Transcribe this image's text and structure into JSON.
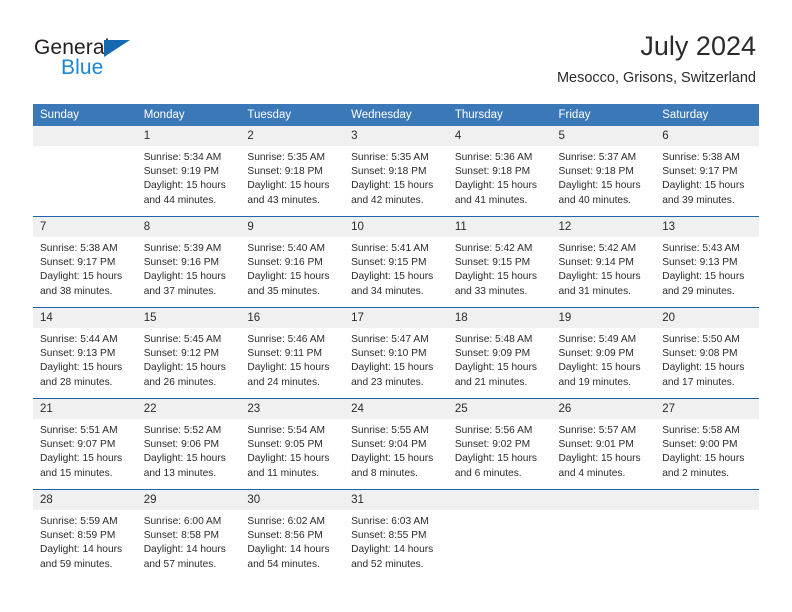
{
  "brand": {
    "name_part1": "General",
    "name_part2": "Blue",
    "triangle_icon": "triangle-icon",
    "accent_dark": "#231f20",
    "accent_blue": "#1b87d4",
    "triangle_blue": "#1469b0"
  },
  "header": {
    "title": "July 2024",
    "subtitle": "Mesocco, Grisons, Switzerland"
  },
  "theme": {
    "header_bg": "#3b78b8",
    "row_border": "#1f64a8",
    "daynum_bg": "#f0f0f0",
    "text": "#2b2b2b"
  },
  "weekday_headers": [
    "Sunday",
    "Monday",
    "Tuesday",
    "Wednesday",
    "Thursday",
    "Friday",
    "Saturday"
  ],
  "weeks": [
    [
      {
        "day": "",
        "details": ""
      },
      {
        "day": "1",
        "details": "Sunrise: 5:34 AM\nSunset: 9:19 PM\nDaylight: 15 hours\nand 44 minutes."
      },
      {
        "day": "2",
        "details": "Sunrise: 5:35 AM\nSunset: 9:18 PM\nDaylight: 15 hours\nand 43 minutes."
      },
      {
        "day": "3",
        "details": "Sunrise: 5:35 AM\nSunset: 9:18 PM\nDaylight: 15 hours\nand 42 minutes."
      },
      {
        "day": "4",
        "details": "Sunrise: 5:36 AM\nSunset: 9:18 PM\nDaylight: 15 hours\nand 41 minutes."
      },
      {
        "day": "5",
        "details": "Sunrise: 5:37 AM\nSunset: 9:18 PM\nDaylight: 15 hours\nand 40 minutes."
      },
      {
        "day": "6",
        "details": "Sunrise: 5:38 AM\nSunset: 9:17 PM\nDaylight: 15 hours\nand 39 minutes."
      }
    ],
    [
      {
        "day": "7",
        "details": "Sunrise: 5:38 AM\nSunset: 9:17 PM\nDaylight: 15 hours\nand 38 minutes."
      },
      {
        "day": "8",
        "details": "Sunrise: 5:39 AM\nSunset: 9:16 PM\nDaylight: 15 hours\nand 37 minutes."
      },
      {
        "day": "9",
        "details": "Sunrise: 5:40 AM\nSunset: 9:16 PM\nDaylight: 15 hours\nand 35 minutes."
      },
      {
        "day": "10",
        "details": "Sunrise: 5:41 AM\nSunset: 9:15 PM\nDaylight: 15 hours\nand 34 minutes."
      },
      {
        "day": "11",
        "details": "Sunrise: 5:42 AM\nSunset: 9:15 PM\nDaylight: 15 hours\nand 33 minutes."
      },
      {
        "day": "12",
        "details": "Sunrise: 5:42 AM\nSunset: 9:14 PM\nDaylight: 15 hours\nand 31 minutes."
      },
      {
        "day": "13",
        "details": "Sunrise: 5:43 AM\nSunset: 9:13 PM\nDaylight: 15 hours\nand 29 minutes."
      }
    ],
    [
      {
        "day": "14",
        "details": "Sunrise: 5:44 AM\nSunset: 9:13 PM\nDaylight: 15 hours\nand 28 minutes."
      },
      {
        "day": "15",
        "details": "Sunrise: 5:45 AM\nSunset: 9:12 PM\nDaylight: 15 hours\nand 26 minutes."
      },
      {
        "day": "16",
        "details": "Sunrise: 5:46 AM\nSunset: 9:11 PM\nDaylight: 15 hours\nand 24 minutes."
      },
      {
        "day": "17",
        "details": "Sunrise: 5:47 AM\nSunset: 9:10 PM\nDaylight: 15 hours\nand 23 minutes."
      },
      {
        "day": "18",
        "details": "Sunrise: 5:48 AM\nSunset: 9:09 PM\nDaylight: 15 hours\nand 21 minutes."
      },
      {
        "day": "19",
        "details": "Sunrise: 5:49 AM\nSunset: 9:09 PM\nDaylight: 15 hours\nand 19 minutes."
      },
      {
        "day": "20",
        "details": "Sunrise: 5:50 AM\nSunset: 9:08 PM\nDaylight: 15 hours\nand 17 minutes."
      }
    ],
    [
      {
        "day": "21",
        "details": "Sunrise: 5:51 AM\nSunset: 9:07 PM\nDaylight: 15 hours\nand 15 minutes."
      },
      {
        "day": "22",
        "details": "Sunrise: 5:52 AM\nSunset: 9:06 PM\nDaylight: 15 hours\nand 13 minutes."
      },
      {
        "day": "23",
        "details": "Sunrise: 5:54 AM\nSunset: 9:05 PM\nDaylight: 15 hours\nand 11 minutes."
      },
      {
        "day": "24",
        "details": "Sunrise: 5:55 AM\nSunset: 9:04 PM\nDaylight: 15 hours\nand 8 minutes."
      },
      {
        "day": "25",
        "details": "Sunrise: 5:56 AM\nSunset: 9:02 PM\nDaylight: 15 hours\nand 6 minutes."
      },
      {
        "day": "26",
        "details": "Sunrise: 5:57 AM\nSunset: 9:01 PM\nDaylight: 15 hours\nand 4 minutes."
      },
      {
        "day": "27",
        "details": "Sunrise: 5:58 AM\nSunset: 9:00 PM\nDaylight: 15 hours\nand 2 minutes."
      }
    ],
    [
      {
        "day": "28",
        "details": "Sunrise: 5:59 AM\nSunset: 8:59 PM\nDaylight: 14 hours\nand 59 minutes."
      },
      {
        "day": "29",
        "details": "Sunrise: 6:00 AM\nSunset: 8:58 PM\nDaylight: 14 hours\nand 57 minutes."
      },
      {
        "day": "30",
        "details": "Sunrise: 6:02 AM\nSunset: 8:56 PM\nDaylight: 14 hours\nand 54 minutes."
      },
      {
        "day": "31",
        "details": "Sunrise: 6:03 AM\nSunset: 8:55 PM\nDaylight: 14 hours\nand 52 minutes."
      },
      {
        "day": "",
        "details": ""
      },
      {
        "day": "",
        "details": ""
      },
      {
        "day": "",
        "details": ""
      }
    ]
  ]
}
